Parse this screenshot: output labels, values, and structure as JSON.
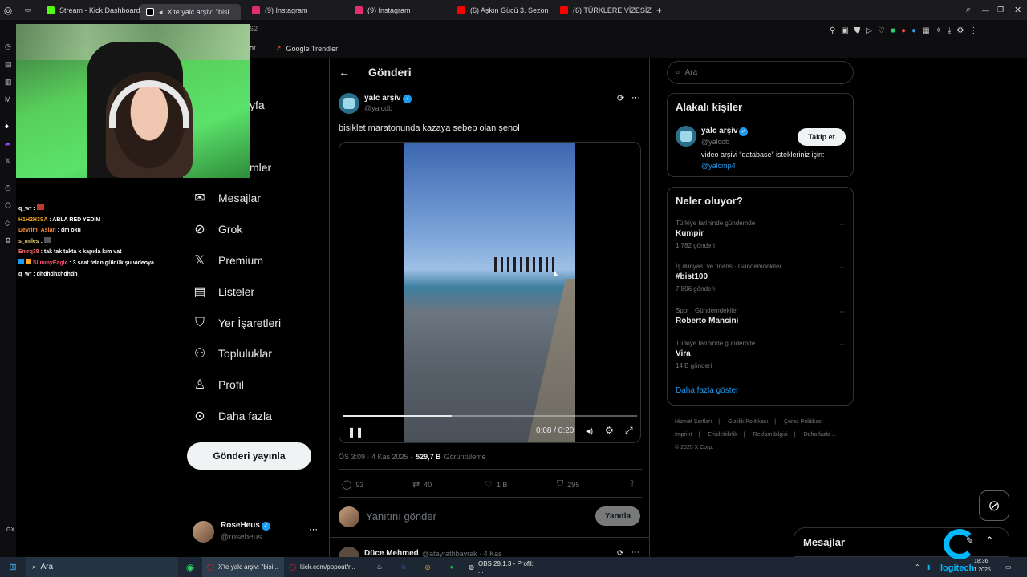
{
  "browser": {
    "tabs": [
      {
        "label": "Stream - Kick Dashboard",
        "icon": "kick-icon",
        "color": "#53fc18"
      },
      {
        "label": "X'te yalc arşiv: \"bisi...",
        "icon": "x-icon",
        "color": "#ffffff",
        "active": true
      },
      {
        "label": "(9) Instagram",
        "icon": "instagram-icon",
        "color": "#e1306c"
      },
      {
        "label": "(9) Instagram",
        "icon": "instagram-icon",
        "color": "#e1306c"
      },
      {
        "label": "(6) Aşkın Gücü 3. Sezon",
        "icon": "youtube-icon",
        "color": "#ff0000"
      },
      {
        "label": "(6) TÜRKLERE VİZESİZ O...",
        "icon": "youtube-icon",
        "color": "#ff0000"
      }
    ],
    "bookmark_fragment": "ot...",
    "bookmark_trends": "Google Trendler",
    "tab_fragment": "62"
  },
  "chat": [
    {
      "user": "q_wr",
      "msg": "",
      "color": "#ffffff"
    },
    {
      "user": "H1H2H3SA",
      "msg": "ABLA RED YEDİM",
      "color": "#f5a623"
    },
    {
      "user": "Devrim_Aslan",
      "msg": "dm oku",
      "color": "#ff8a3d"
    },
    {
      "user": "s_miles",
      "msg": "",
      "color": "#f5d76e"
    },
    {
      "user": "Emrq38",
      "msg": "tak tak takta k kapıda kım vat",
      "color": "#ff6b6b"
    },
    {
      "user": "SlimmyEagle",
      "msg": "3 saat felan güldük şu videoya",
      "color": "#ff4d6d"
    },
    {
      "user": "q_wr",
      "msg": "dhdhdhxhdhdh",
      "color": "#ffffff"
    }
  ],
  "sidebar": {
    "partial_items": [
      "yfa",
      "mler"
    ],
    "items": [
      {
        "label": "Mesajlar",
        "icon": "mail-icon"
      },
      {
        "label": "Grok",
        "icon": "grok-icon"
      },
      {
        "label": "Premium",
        "icon": "x-logo-icon"
      },
      {
        "label": "Listeler",
        "icon": "list-icon"
      },
      {
        "label": "Yer İşaretleri",
        "icon": "bookmark-icon"
      },
      {
        "label": "Topluluklar",
        "icon": "communities-icon"
      },
      {
        "label": "Profil",
        "icon": "profile-icon"
      },
      {
        "label": "Daha fazla",
        "icon": "more-icon"
      }
    ],
    "post_button": "Gönderi yayınla",
    "account": {
      "name": "RoseHeus",
      "handle": "@roseheus"
    }
  },
  "post": {
    "header": "Gönderi",
    "author": "yalc arşiv",
    "handle": "@yalcdb",
    "text": "bisiklet maratonunda kazaya sebep olan şenol",
    "video_time": "0:08 / 0:20",
    "progress": 0.37,
    "meta_time": "ÖS 3:09 · 4 Kas 2025 ·",
    "views": "529,7 B",
    "views_label": "Görüntüleme",
    "replies": "93",
    "reposts": "40",
    "likes": "1 B",
    "bookmarks": "295",
    "reply_placeholder": "Yanıtını gönder",
    "reply_button": "Yanıtla",
    "next_reply_author": "Düce Mehmed",
    "next_reply_handle": "@atayrathbayrak · 4 Kas"
  },
  "right": {
    "search_placeholder": "Ara",
    "related_title": "Alakalı kişiler",
    "related": {
      "name": "yalc arşiv",
      "handle": "@yalcdb",
      "bio": "video arşivi “database” istekleriniz için:",
      "link": "@yalcmp4",
      "button": "Takip et"
    },
    "trends_title": "Neler oluyor?",
    "trends": [
      {
        "category": "Türkiye tarihinde gündemde",
        "name": "Kumpir",
        "count": "1.782 gönderi"
      },
      {
        "category": "İş dünyası ve finans · Gündemdekiler",
        "name": "#bist100",
        "count": "7.806 gönderi"
      },
      {
        "category": "Spor · Gündemdekiler",
        "name": "Roberto Mancini",
        "count": ""
      },
      {
        "category": "Türkiye tarihinde gündemde",
        "name": "Vira",
        "count": "14 B gönderi"
      }
    ],
    "show_more": "Daha fazla göster",
    "footer": [
      "Hizmet Şartları",
      "|",
      "Gizlilik Politikası",
      "|",
      "Çerez Politikası",
      "|",
      "Imprint",
      "|",
      "Erişilebilirlik",
      "|",
      "Reklam bilgisi",
      "|",
      "Daha fazla ...",
      "© 2025 X Corp."
    ]
  },
  "messages_drawer": "Mesajlar",
  "taskbar": {
    "search": "Ara",
    "items": [
      {
        "label": "X'te yalc arşiv: \"bisi..."
      },
      {
        "label": "kick.com/popout/r..."
      },
      {
        "label": "OBS 29.1.3 - Profil: ..."
      }
    ],
    "time": "18:36",
    "date": "11.2025",
    "watermark": "logitech"
  }
}
